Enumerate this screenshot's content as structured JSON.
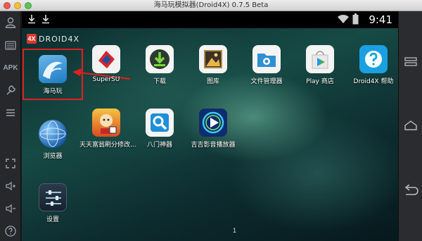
{
  "window": {
    "title": "海马玩模拟器(Droid4X) 0.7.5 Beta"
  },
  "statusbar": {
    "time": "9:41"
  },
  "brand": {
    "mark": "4X",
    "text": "DROID4X"
  },
  "left_rail": {
    "apk_label": "APK"
  },
  "apps": [
    {
      "label": "海马玩",
      "icon": "haima-icon"
    },
    {
      "label": "SuperSU",
      "icon": "supersu-icon"
    },
    {
      "label": "下载",
      "icon": "download-icon"
    },
    {
      "label": "图库",
      "icon": "gallery-icon"
    },
    {
      "label": "文件管理器",
      "icon": "file-manager-icon"
    },
    {
      "label": "Play 商店",
      "icon": "play-store-icon"
    },
    {
      "label": "Droid4X 帮助",
      "icon": "help-icon"
    },
    {
      "label": "浏览器",
      "icon": "browser-icon"
    },
    {
      "label": "天天富翁刷分修改...",
      "icon": "game-icon"
    },
    {
      "label": "八门神器",
      "icon": "search-app-icon"
    },
    {
      "label": "吉吉影音播放器",
      "icon": "video-player-icon"
    },
    {
      "label": "设置",
      "icon": "settings-icon"
    }
  ],
  "page_indicator": "1",
  "colors": {
    "highlight": "#e12020",
    "arrow": "#e12020",
    "titlebar": "#d8d8d8"
  }
}
